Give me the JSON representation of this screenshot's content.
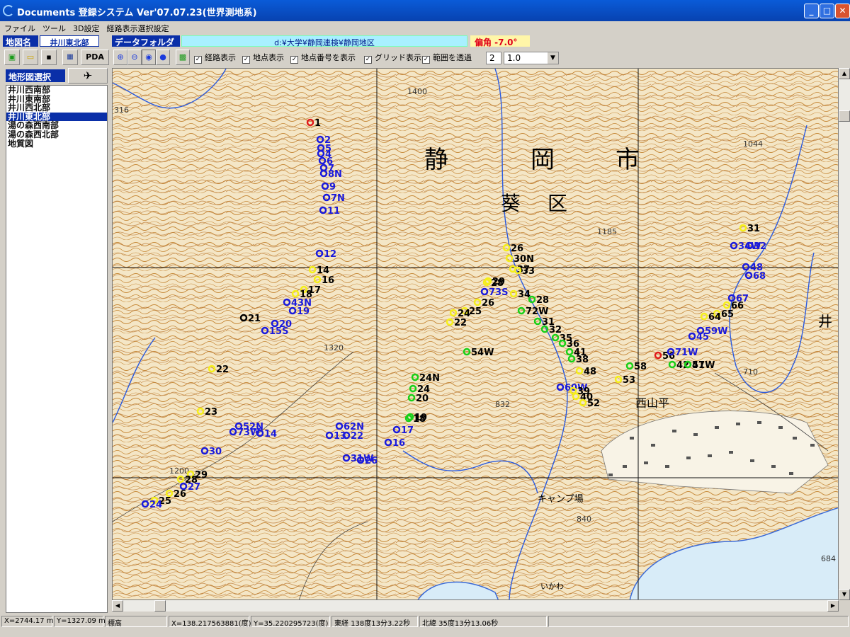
{
  "window": {
    "title": "Documents  登録システム Ver'07.07.23(世界測地系)"
  },
  "menu": [
    "ファイル",
    "ツール",
    "3D設定",
    "経路表示選択設定"
  ],
  "info": {
    "map_label": "地図名",
    "map_name": "井川東北部",
    "folder_label": "データフォルダ",
    "folder_path": "d:¥大学¥静岡連検¥静岡地区",
    "declination": "偏角 -7.0°"
  },
  "toolbar": {
    "pda_label": "PDA",
    "checks": [
      "経路表示",
      "地点表示",
      "地点番号を表示",
      "グリッド表示",
      "範囲を透過"
    ],
    "num_value": "2",
    "scale_value": "1.0"
  },
  "sidebar": {
    "title": "地形図選択",
    "items": [
      "井川西南部",
      "井川東南部",
      "井川西北部",
      "井川東北部",
      "湯の森西南部",
      "湯の森西北部",
      "地質図"
    ],
    "selected": "井川東北部"
  },
  "map": {
    "place_chars": [
      "静",
      "岡",
      "市"
    ],
    "ward_chars": [
      "葵",
      "区"
    ],
    "elevations": [
      "1400",
      "1185",
      "1044",
      "1320",
      "832",
      "840",
      "684",
      "710",
      "1200",
      "316"
    ],
    "place_labels": [
      "西山平",
      "井",
      "キャンプ場",
      "いかわ"
    ],
    "colors": {
      "yellow": "#f5ef1a",
      "blue": "#1a1adc",
      "green": "#18d018",
      "red": "#e01a1a",
      "black": "#000000"
    }
  },
  "points": [
    {
      "n": "1",
      "c": "red"
    },
    {
      "n": "2",
      "c": "blue"
    },
    {
      "n": "5",
      "c": "blue"
    },
    {
      "n": "4",
      "c": "blue"
    },
    {
      "n": "6",
      "c": "blue"
    },
    {
      "n": "7",
      "c": "blue"
    },
    {
      "n": "8N",
      "c": "blue"
    },
    {
      "n": "9",
      "c": "blue"
    },
    {
      "n": "7N",
      "c": "blue"
    },
    {
      "n": "11",
      "c": "blue"
    },
    {
      "n": "12",
      "c": "blue"
    },
    {
      "n": "14",
      "c": "yellow"
    },
    {
      "n": "16",
      "c": "yellow"
    },
    {
      "n": "17",
      "c": "yellow"
    },
    {
      "n": "18",
      "c": "yellow"
    },
    {
      "n": "43N",
      "c": "blue"
    },
    {
      "n": "19",
      "c": "blue"
    },
    {
      "n": "21",
      "c": "black"
    },
    {
      "n": "20",
      "c": "blue"
    },
    {
      "n": "15S",
      "c": "blue"
    },
    {
      "n": "22",
      "c": "yellow"
    },
    {
      "n": "23",
      "c": "yellow"
    },
    {
      "n": "30",
      "c": "blue"
    },
    {
      "n": "29",
      "c": "yellow"
    },
    {
      "n": "28",
      "c": "yellow"
    },
    {
      "n": "27",
      "c": "blue"
    },
    {
      "n": "26",
      "c": "yellow"
    },
    {
      "n": "25",
      "c": "yellow"
    },
    {
      "n": "24",
      "c": "blue"
    },
    {
      "n": "52N",
      "c": "blue"
    },
    {
      "n": "73W",
      "c": "blue"
    },
    {
      "n": "14",
      "c": "blue"
    },
    {
      "n": "13",
      "c": "blue"
    },
    {
      "n": "22",
      "c": "blue"
    },
    {
      "n": "62N",
      "c": "blue"
    },
    {
      "n": "31W",
      "c": "blue"
    },
    {
      "n": "26",
      "c": "blue"
    },
    {
      "n": "24N",
      "c": "green"
    },
    {
      "n": "24",
      "c": "green"
    },
    {
      "n": "20",
      "c": "green"
    },
    {
      "n": "19",
      "c": "green"
    },
    {
      "n": "18",
      "c": "green"
    },
    {
      "n": "17",
      "c": "blue"
    },
    {
      "n": "16",
      "c": "blue"
    },
    {
      "n": "26",
      "c": "yellow"
    },
    {
      "n": "30N",
      "c": "yellow"
    },
    {
      "n": "37",
      "c": "yellow"
    },
    {
      "n": "33",
      "c": "yellow"
    },
    {
      "n": "29",
      "c": "yellow"
    },
    {
      "n": "28",
      "c": "yellow"
    },
    {
      "n": "73S",
      "c": "blue"
    },
    {
      "n": "26",
      "c": "yellow"
    },
    {
      "n": "25",
      "c": "yellow"
    },
    {
      "n": "24",
      "c": "yellow"
    },
    {
      "n": "22",
      "c": "yellow"
    },
    {
      "n": "34",
      "c": "yellow"
    },
    {
      "n": "28",
      "c": "green"
    },
    {
      "n": "72W",
      "c": "green"
    },
    {
      "n": "31",
      "c": "green"
    },
    {
      "n": "32",
      "c": "green"
    },
    {
      "n": "35",
      "c": "green"
    },
    {
      "n": "36",
      "c": "green"
    },
    {
      "n": "41",
      "c": "green"
    },
    {
      "n": "38",
      "c": "green"
    },
    {
      "n": "48",
      "c": "yellow"
    },
    {
      "n": "60W",
      "c": "blue"
    },
    {
      "n": "39",
      "c": "yellow"
    },
    {
      "n": "40",
      "c": "yellow"
    },
    {
      "n": "52",
      "c": "yellow"
    },
    {
      "n": "53",
      "c": "yellow"
    },
    {
      "n": "31",
      "c": "yellow"
    },
    {
      "n": "34W",
      "c": "blue"
    },
    {
      "n": "32",
      "c": "blue"
    },
    {
      "n": "48",
      "c": "blue"
    },
    {
      "n": "68",
      "c": "blue"
    },
    {
      "n": "67",
      "c": "blue"
    },
    {
      "n": "66",
      "c": "yellow"
    },
    {
      "n": "65",
      "c": "yellow"
    },
    {
      "n": "64",
      "c": "yellow"
    },
    {
      "n": "59W",
      "c": "blue"
    },
    {
      "n": "45",
      "c": "blue"
    },
    {
      "n": "56",
      "c": "red"
    },
    {
      "n": "71W",
      "c": "blue"
    },
    {
      "n": "42",
      "c": "green"
    },
    {
      "n": "57W",
      "c": "green"
    },
    {
      "n": "41",
      "c": "green"
    },
    {
      "n": "58",
      "c": "green"
    },
    {
      "n": "54W",
      "c": "green"
    }
  ],
  "status": {
    "x": "X=2744.17 m",
    "y": "Y=1327.09 m",
    "elev": "標高",
    "lon_deg": "X=138.217563881(度)",
    "lat_deg": "Y=35.220295723(度)",
    "lon_dms": "東経 138度13分3.22秒",
    "lat_dms": "北緯 35度13分13.06秒"
  }
}
